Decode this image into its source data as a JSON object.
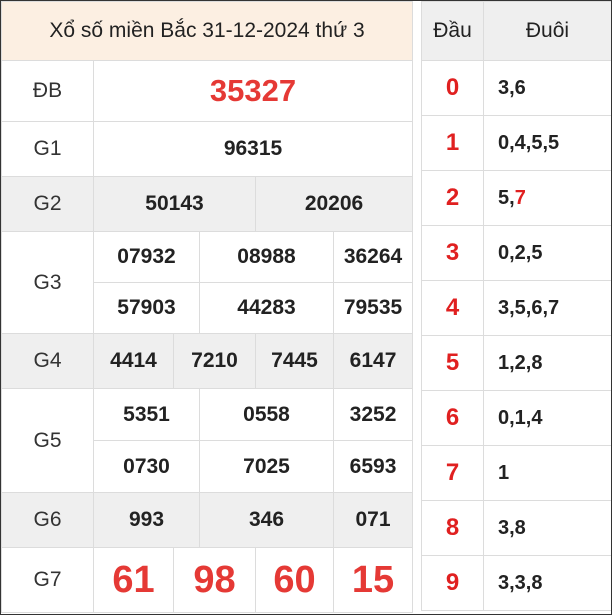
{
  "title": "Xổ số miền Bắc 31-12-2024 thứ 3",
  "prizes": {
    "db": {
      "label": "ĐB",
      "numbers": [
        "35327"
      ]
    },
    "g1": {
      "label": "G1",
      "numbers": [
        "96315"
      ]
    },
    "g2": {
      "label": "G2",
      "numbers": [
        "50143",
        "20206"
      ]
    },
    "g3": {
      "label": "G3",
      "numbers": [
        "07932",
        "08988",
        "36264",
        "57903",
        "44283",
        "79535"
      ]
    },
    "g4": {
      "label": "G4",
      "numbers": [
        "4414",
        "7210",
        "7445",
        "6147"
      ]
    },
    "g5": {
      "label": "G5",
      "numbers": [
        "5351",
        "0558",
        "3252",
        "0730",
        "7025",
        "6593"
      ]
    },
    "g6": {
      "label": "G6",
      "numbers": [
        "993",
        "346",
        "071"
      ]
    },
    "g7": {
      "label": "G7",
      "numbers": [
        "61",
        "98",
        "60",
        "15"
      ]
    }
  },
  "loto": {
    "head_label": "Đầu",
    "tail_label": "Đuôi",
    "rows": [
      {
        "head": "0",
        "tail": "3,6"
      },
      {
        "head": "1",
        "tail": "0,4,5,5"
      },
      {
        "head": "2",
        "tail_plain": "5,",
        "tail_highlight": "7"
      },
      {
        "head": "3",
        "tail": "0,2,5"
      },
      {
        "head": "4",
        "tail": "3,5,6,7"
      },
      {
        "head": "5",
        "tail": "1,2,8"
      },
      {
        "head": "6",
        "tail": "0,1,4"
      },
      {
        "head": "7",
        "tail": "1"
      },
      {
        "head": "8",
        "tail": "3,8"
      },
      {
        "head": "9",
        "tail": "3,3,8"
      }
    ]
  },
  "colors": {
    "accent_red": "#e53935",
    "header_bg": "#fcefe2",
    "stripe_bg": "#efefef"
  }
}
